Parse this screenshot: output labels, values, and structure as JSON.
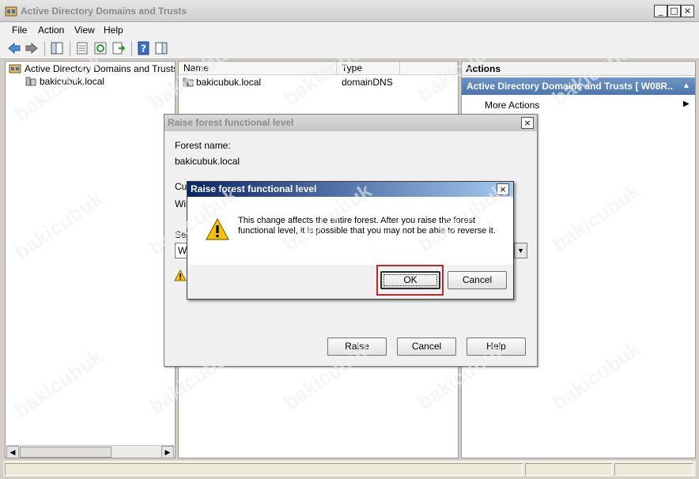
{
  "window": {
    "title": "Active Directory Domains and Trusts",
    "controls": [
      "_",
      "□",
      "×"
    ]
  },
  "menu": [
    "File",
    "Action",
    "View",
    "Help"
  ],
  "toolbar": {
    "icons": [
      "back-icon",
      "forward-icon",
      "show-hide-console-tree-icon",
      "properties-icon",
      "refresh-icon",
      "export-list-icon",
      "help-icon",
      "show-hide-action-pane-icon"
    ]
  },
  "tree": {
    "root_label": "Active Directory Domains and Trusts [ W",
    "child_label": "bakicubuk.local"
  },
  "list": {
    "columns": [
      "Name",
      "Type"
    ],
    "rows": [
      {
        "name": "bakicubuk.local",
        "type": "domainDNS"
      }
    ]
  },
  "actions": {
    "header": "Actions",
    "section": "Active Directory Domains and Trusts [ W08R...",
    "items": [
      "More Actions"
    ]
  },
  "dialog_raise": {
    "title": "Raise forest functional level",
    "forest_name_label": "Forest name:",
    "forest_name_value": "bakicubuk.local",
    "current_label_partial": "Cur",
    "current_value_partial": "Wir",
    "select_label_partial": "Sel",
    "select_value_partial": "W",
    "buttons": {
      "raise": "Raise",
      "cancel": "Cancel",
      "help": "Help"
    }
  },
  "dialog_confirm": {
    "title": "Raise forest functional level",
    "message": "This change affects the entire forest. After you raise the forest functional level, it is possible that you may not be able to reverse it.",
    "buttons": {
      "ok": "OK",
      "cancel": "Cancel"
    }
  },
  "watermark": "bakicubuk",
  "colors": {
    "accent_blue": "#0a246a",
    "action_header": "#4a76ae",
    "highlight": "#c0272d"
  }
}
